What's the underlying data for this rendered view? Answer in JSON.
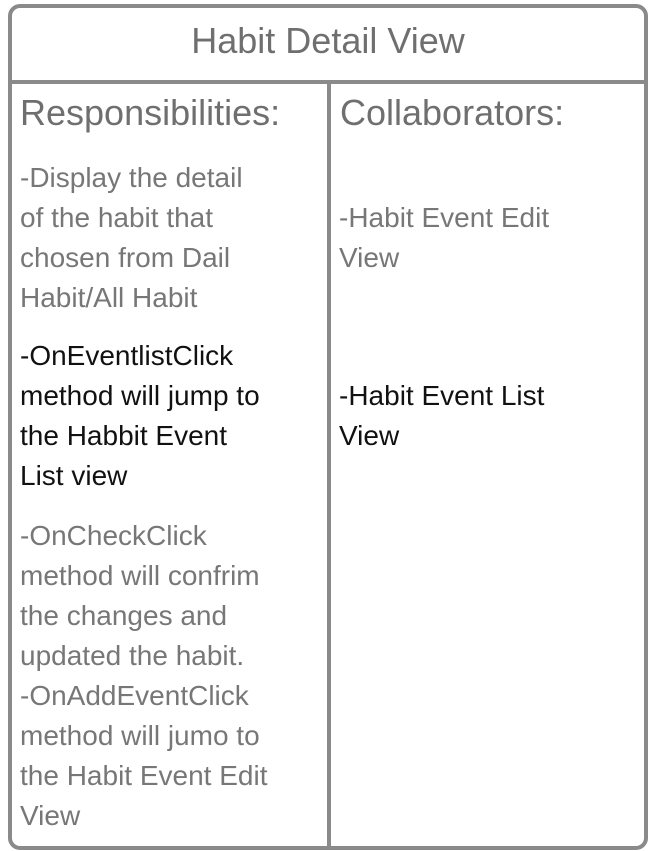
{
  "title": "Habit Detail View",
  "responsibilities": {
    "header": "Responsibilities:",
    "items": [
      "-Display the detail\nof the habit that\nchosen from Dail\nHabit/All Habit",
      "-OnEventlistClick\nmethod will jump to\nthe Habbit Event\nList view",
      "-OnCheckClick\nmethod will confrim\nthe changes and\nupdated the habit.\n-OnAddEventClick\nmethod will jumo to\nthe Habit Event Edit\nView"
    ]
  },
  "collaborators": {
    "header": "Collaborators:",
    "items": [
      "-Habit Event Edit\nView",
      "-Habit Event List\nView"
    ]
  },
  "colors": {
    "border": "#8a8a8a",
    "muted_text": "#777777",
    "emphasis_text": "#111111"
  }
}
